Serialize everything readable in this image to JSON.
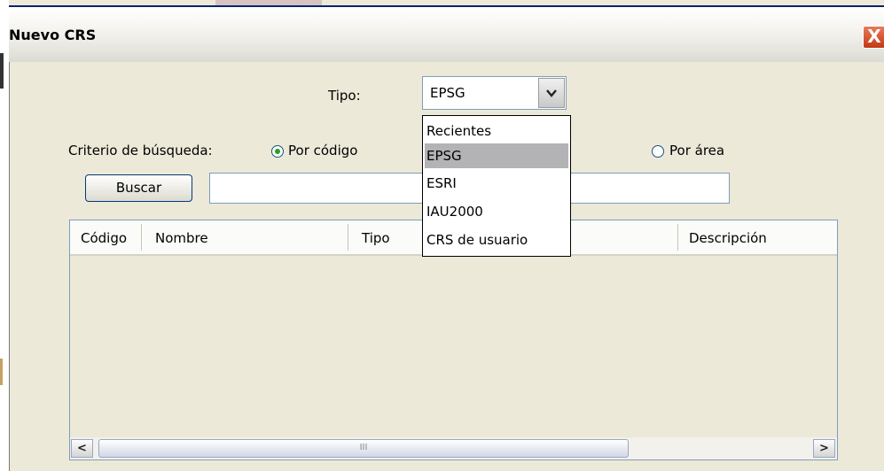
{
  "window": {
    "title": "Nuevo CRS",
    "close_glyph": "X"
  },
  "tipo": {
    "label": "Tipo:",
    "value": "EPSG",
    "arrow_icon": "chevron-down-icon",
    "options": [
      "Recientes",
      "EPSG",
      "ESRI",
      "IAU2000",
      "CRS de usuario"
    ],
    "highlighted_option": "EPSG"
  },
  "criteria": {
    "label": "Criterio de búsqueda:",
    "by_code": {
      "label": "Por código",
      "selected": true
    },
    "by_area": {
      "label": "Por área",
      "selected": false
    }
  },
  "search": {
    "button_label": "Buscar",
    "value": ""
  },
  "table": {
    "columns": [
      "Código",
      "Nombre",
      "Tipo",
      "",
      "Descripción"
    ],
    "rows": [],
    "scroll_thumb_glyph": "III"
  },
  "colors": {
    "accent_radio": "#21a121",
    "dropdown_highlight": "#b3b3b6",
    "close_button": "#c03a15"
  }
}
